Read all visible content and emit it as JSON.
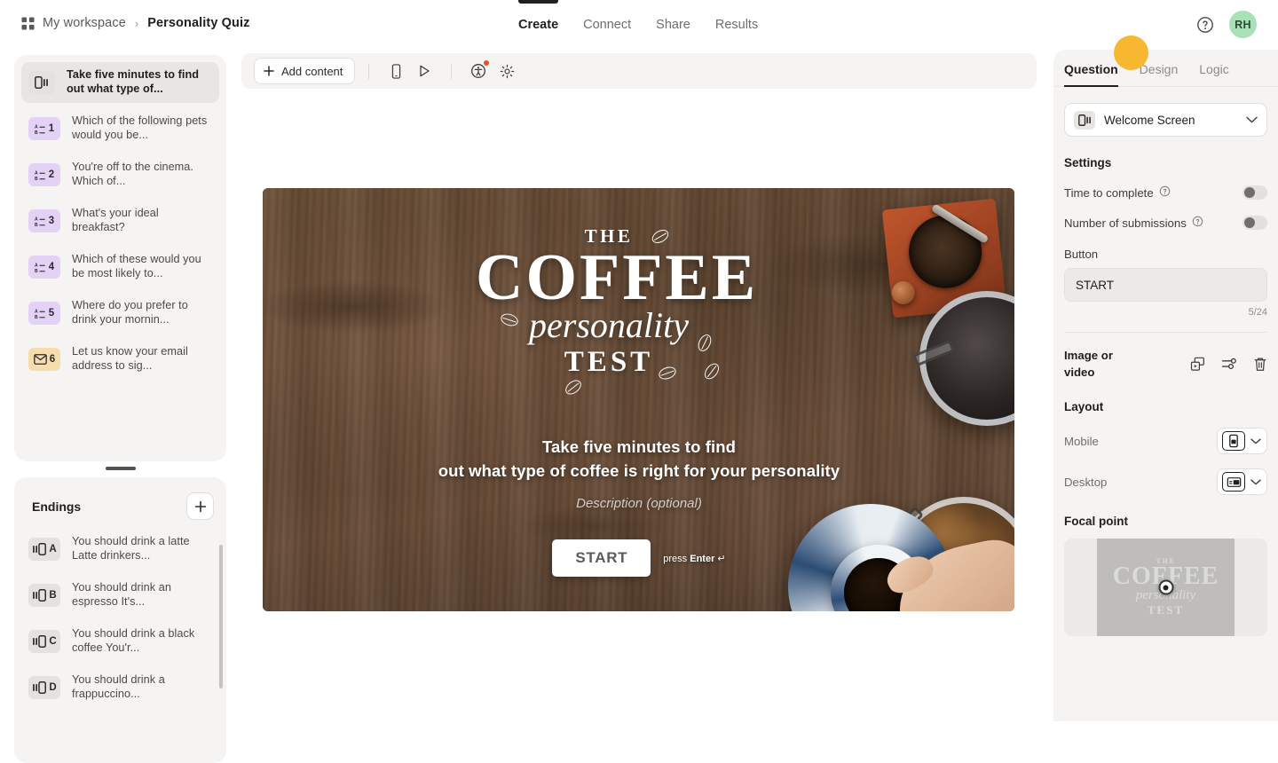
{
  "header": {
    "workspace": "My workspace",
    "separator": "›",
    "project": "Personality Quiz",
    "tabs": [
      {
        "label": "Create",
        "active": true
      },
      {
        "label": "Connect",
        "active": false
      },
      {
        "label": "Share",
        "active": false
      },
      {
        "label": "Results",
        "active": false
      }
    ],
    "help_icon": "help-circle-icon",
    "avatar_initials": "RH",
    "avatar_color": "#a8e0b8"
  },
  "sidebar": {
    "questions": [
      {
        "badge": "",
        "type": "welcome",
        "title": "Take five minutes to find out what type of...",
        "selected": true
      },
      {
        "badge": "1",
        "type": "multiple-choice",
        "title": "Which of the following pets would you be...",
        "selected": false
      },
      {
        "badge": "2",
        "type": "multiple-choice",
        "title": "You're off to the cinema. Which of...",
        "selected": false
      },
      {
        "badge": "3",
        "type": "multiple-choice",
        "title": "What's your ideal breakfast?",
        "selected": false
      },
      {
        "badge": "4",
        "type": "multiple-choice",
        "title": "Which of these would you be most likely to...",
        "selected": false
      },
      {
        "badge": "5",
        "type": "multiple-choice",
        "title": "Where do you prefer to drink your mornin...",
        "selected": false
      },
      {
        "badge": "6",
        "type": "email",
        "title": "Let us know your email address to sig...",
        "selected": false
      }
    ],
    "endings": {
      "title": "Endings",
      "add_label": "+",
      "items": [
        {
          "badge": "A",
          "title": "You should drink a latte Latte drinkers..."
        },
        {
          "badge": "B",
          "title": "You should drink an espresso It's..."
        },
        {
          "badge": "C",
          "title": "You should drink a black coffee You'r..."
        },
        {
          "badge": "D",
          "title": "You should drink a frappuccino..."
        }
      ]
    }
  },
  "toolbar": {
    "add_content": "Add content",
    "mobile_preview_icon": "mobile-icon",
    "play_icon": "play-icon",
    "accessibility_icon": "accessibility-icon",
    "settings_icon": "gear-icon",
    "has_notification": true
  },
  "slide": {
    "logo_the": "THE",
    "logo_coffee": "COFFEE",
    "logo_personality": "personality",
    "logo_test": "TEST",
    "heading_line1": "Take five minutes to find",
    "heading_line2": "out what type of coffee is right for your personality",
    "description": "Description (optional)",
    "start_button": "START",
    "press_enter_prefix": "press ",
    "press_enter_key": "Enter",
    "press_enter_symbol": "↵"
  },
  "right_panel": {
    "tabs": [
      {
        "label": "Question",
        "active": true
      },
      {
        "label": "Design",
        "active": false
      },
      {
        "label": "Logic",
        "active": false
      }
    ],
    "type_select": {
      "value": "Welcome Screen",
      "icon": "welcome-screen-icon",
      "chevron": "chevron-down-icon"
    },
    "settings_title": "Settings",
    "settings": [
      {
        "label": "Time to complete",
        "help": "help-icon",
        "enabled": false
      },
      {
        "label": "Number of submissions",
        "help": "help-icon",
        "enabled": false
      }
    ],
    "button_label": "Button",
    "button_value": "START",
    "char_count": "5/24",
    "media": {
      "label": "Image or video",
      "replace_icon": "replace-media-icon",
      "adjust_icon": "sliders-icon",
      "delete_icon": "trash-icon"
    },
    "layout_title": "Layout",
    "layout_rows": [
      {
        "label": "Mobile",
        "icon": "mobile-layout-icon"
      },
      {
        "label": "Desktop",
        "icon": "desktop-layout-icon"
      }
    ],
    "focal_point_title": "Focal point",
    "focal_marker": "focal-point-marker"
  }
}
